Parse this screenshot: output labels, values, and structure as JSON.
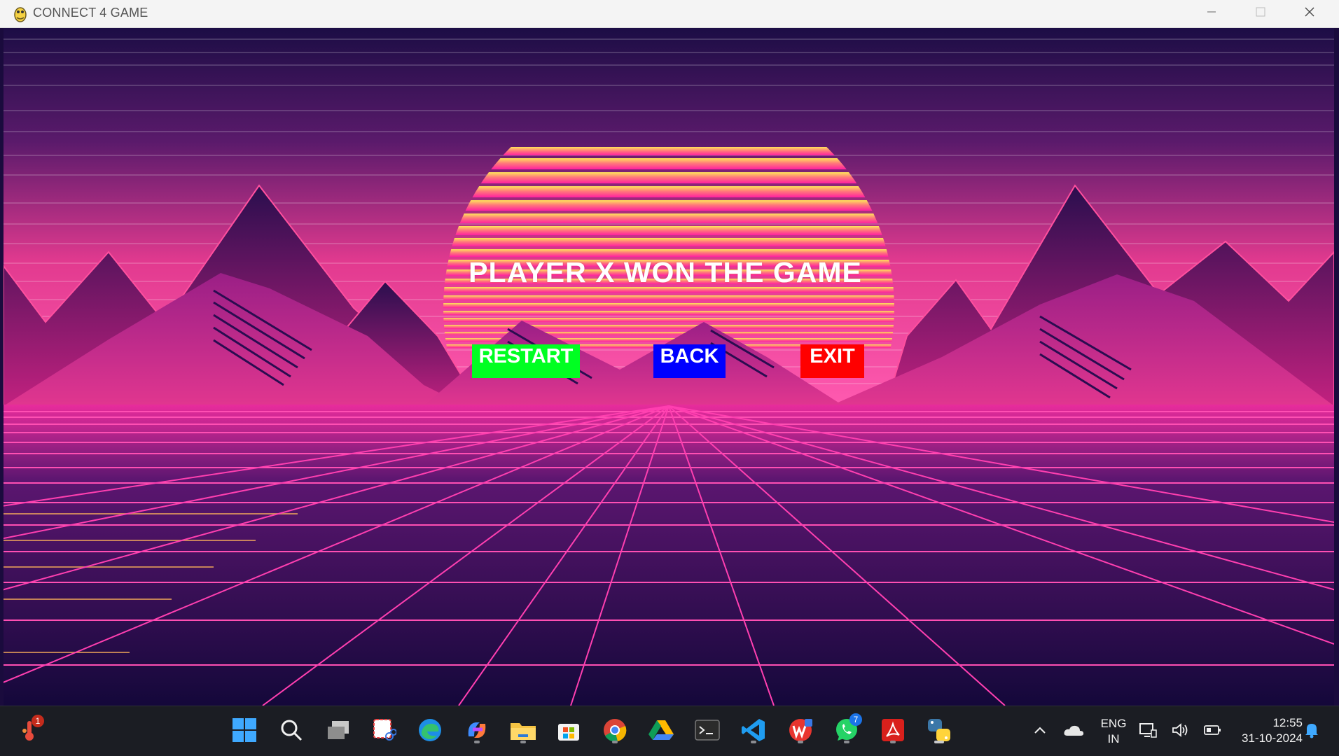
{
  "window": {
    "title": "CONNECT 4 GAME",
    "app_icon": "python-snake-icon",
    "controls": [
      "minimize-icon",
      "maximize-icon",
      "close-icon"
    ]
  },
  "game": {
    "message": "PLAYER X WON THE GAME",
    "buttons": {
      "restart": {
        "label": "RESTART",
        "color": "#00ff22"
      },
      "back": {
        "label": "BACK",
        "color": "#0000ff"
      },
      "exit": {
        "label": "EXIT",
        "color": "#ff0000"
      }
    },
    "background": "synthwave-sunset-grid"
  },
  "taskbar": {
    "left_widget": {
      "icon": "weather-thermometer-icon",
      "badge": "1"
    },
    "apps": [
      {
        "name": "start-icon",
        "running": false
      },
      {
        "name": "search-icon",
        "running": false
      },
      {
        "name": "task-view-icon",
        "running": false
      },
      {
        "name": "snipping-tool-icon",
        "running": false
      },
      {
        "name": "edge-icon",
        "running": false
      },
      {
        "name": "copilot-icon",
        "running": true
      },
      {
        "name": "file-explorer-icon",
        "running": true
      },
      {
        "name": "microsoft-store-icon",
        "running": false
      },
      {
        "name": "chrome-icon",
        "running": true
      },
      {
        "name": "google-drive-icon",
        "running": false
      },
      {
        "name": "terminal-icon",
        "running": false
      },
      {
        "name": "vscode-icon",
        "running": true
      },
      {
        "name": "wps-office-icon",
        "running": true
      },
      {
        "name": "whatsapp-icon",
        "running": true,
        "badge": "7"
      },
      {
        "name": "acrobat-icon",
        "running": true
      },
      {
        "name": "python-icon",
        "running": true
      }
    ],
    "tray": {
      "language_top": "ENG",
      "language_bottom": "IN",
      "time": "12:55",
      "date": "31-10-2024"
    }
  }
}
